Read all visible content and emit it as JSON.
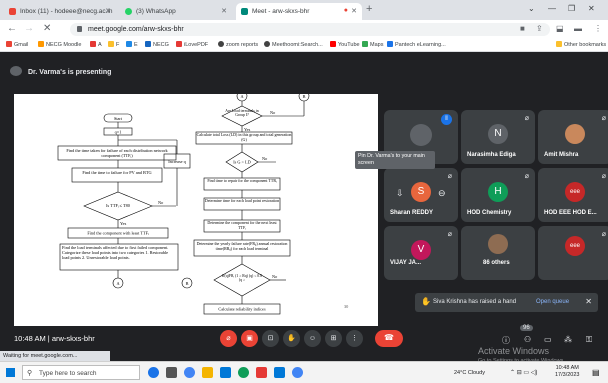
{
  "browser": {
    "tabs": [
      {
        "title": "Inbox (11) - hodeee@necg.ac.in",
        "favicon_color": "#ea4335"
      },
      {
        "title": "(3) WhatsApp",
        "favicon_color": "#25d366"
      },
      {
        "title": "Meet - arw-skxs-bhr",
        "favicon_color": "#00897b",
        "active": true
      }
    ],
    "newtab": "+",
    "window_controls": [
      "⌄",
      "—",
      "❐",
      "✕"
    ],
    "url": "meet.google.com/arw-skxs-bhr",
    "nav": {
      "back": "←",
      "forward": "→",
      "reload": "✕"
    }
  },
  "bookmarks": [
    {
      "label": "Gmail",
      "color": "#ea4335"
    },
    {
      "label": "NECG Moodle",
      "color": "#ff9800"
    },
    {
      "label": "A",
      "color": "#e53935"
    },
    {
      "label": "F",
      "color": "#fbc02d"
    },
    {
      "label": "E",
      "color": "#1e88e5"
    },
    {
      "label": "NECG",
      "color": "#1565c0"
    },
    {
      "label": "iLovePDF",
      "color": "#e53935"
    },
    {
      "label": "zoom reports",
      "color": "#424242"
    },
    {
      "label": "Meethoomi:Search...",
      "color": "#424242"
    },
    {
      "label": "YouTube",
      "color": "#ff0000"
    },
    {
      "label": "Maps",
      "color": "#34a853"
    },
    {
      "label": "Pantech eLearning...",
      "color": "#1a73e8"
    }
  ],
  "other_bookmarks": "Other bookmarks",
  "meet": {
    "presenting": "Dr. Varma's is presenting",
    "tooltip": "Pin Dr. Varma's to your main screen",
    "participants": [
      {
        "name": "",
        "initial": "",
        "avatar_color": "#5f6368",
        "photo": true
      },
      {
        "name": "Narasimha Ediga",
        "initial": "N",
        "avatar_color": "#5f6368"
      },
      {
        "name": "Amit Mishra",
        "initial": "",
        "avatar_color": "#c9885c",
        "photo": true
      },
      {
        "name": "Sharan REDDY",
        "initial": "S",
        "avatar_color": "#e8663d"
      },
      {
        "name": "HOD Chemistry",
        "initial": "H",
        "avatar_color": "#0f9d58"
      },
      {
        "name": "HOD EEE HOD E...",
        "initial": "eee",
        "avatar_color": "#c62828"
      },
      {
        "name": "VIJAY JA...",
        "initial": "V",
        "avatar_color": "#c2185b"
      },
      {
        "name": "86 others",
        "initial": "",
        "avatar_color": "#8e6c52",
        "photo": true
      },
      {
        "name": "",
        "initial": "eee",
        "avatar_color": "#c62828"
      }
    ],
    "time": "10:48 AM",
    "meeting_code": "arw-skxs-bhr",
    "toast": {
      "text": "Siva Krishna has raised a hand",
      "action": "Open queue"
    },
    "watermark": {
      "line1": "Activate Windows",
      "line2": "Go to Settings to activate Windows."
    },
    "controls": [
      "mic-off",
      "camera-off",
      "captions",
      "raise-hand",
      "emoji",
      "present",
      "more"
    ],
    "people_badge": "96"
  },
  "slide": {
    "boxes": {
      "start": "Start",
      "q1": "q=1",
      "find_time_taken": "Find the time taken for failure of each distribution network component (TTFᵢ)",
      "find_time_pv": "Find the time to failure for PV and BTG",
      "decision_ttf": "Is TTFᵢ ≤ T80",
      "increase_q": "Increase q",
      "find_least": "Find the component with least TTFᵢ",
      "find_load": "Find the load terminals affected due to first failed component. Categorize these load points into two categories 1. Restorable load points 2. Unrestorable load points.",
      "a_bottom": "A",
      "b_bottom": "B",
      "a_top": "A",
      "b_top": "B",
      "is_load": "Are Load terminals in Group I?",
      "calc_lol": "Calculate total Loss (LD) in this group and total generation (G)",
      "decision_ld": "Is G > LD",
      "find_repair": "Find time to repair for the component TTRᵢ",
      "determine_time": "Determine time for each load point restoration",
      "determine_component": "Determine the component for the next least TTFᵢ",
      "determine_yearly": "Determine the yearly failure rate(FRᵢⱼ) annual restoration time(RRᵢⱼ) for each load terminal",
      "decision_final": "If(q)FRᵢ (1 ≥ Rq) (q) ≤ 0.8 (q ≥",
      "calc_reliability": "Calculate reliability indices",
      "yes": "Yes",
      "no": "No",
      "page": "30"
    }
  },
  "status_text": "Waiting for meet.google.com...",
  "taskbar": {
    "search_placeholder": "Type here to search",
    "weather": "24°C Cloudy",
    "clock_time": "10:48 AM",
    "clock_date": "17/3/2023"
  }
}
